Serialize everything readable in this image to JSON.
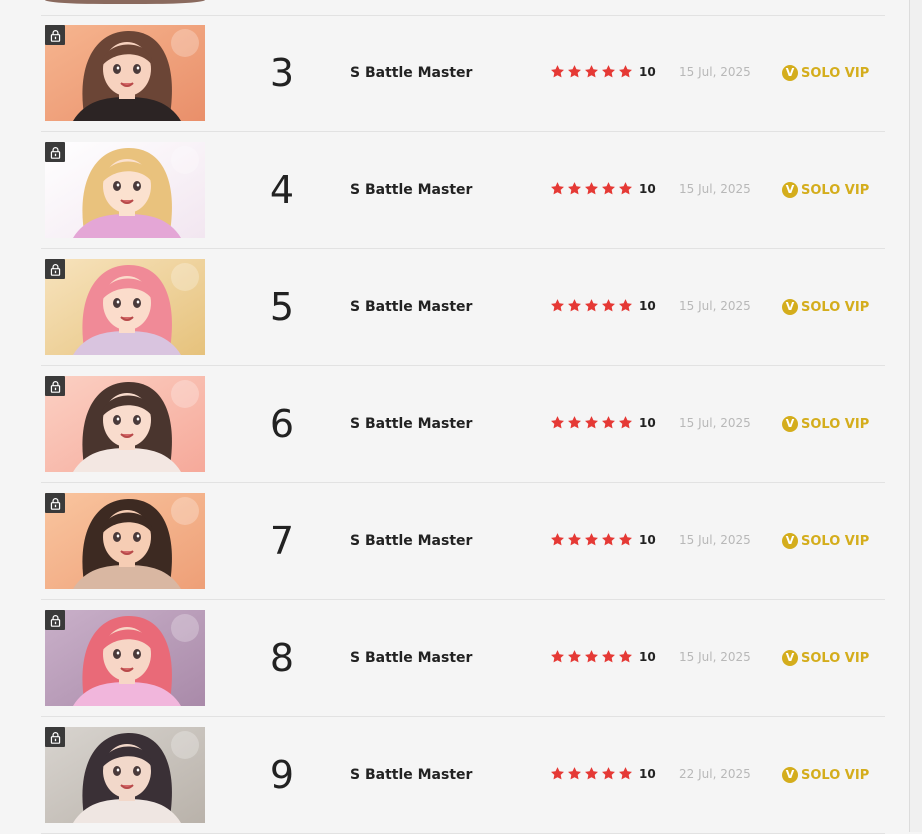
{
  "chapters": [
    {
      "number": "3",
      "title": "S Battle Master",
      "rating": "10",
      "date": "15 Jul, 2025",
      "vip_label": "SOLO VIP",
      "vip_icon": "V",
      "bg1": "#f6b58f",
      "bg2": "#e98f6a",
      "hair": "#6b4536",
      "skin": "#f7d2bf",
      "outfit": "#2c2424"
    },
    {
      "number": "4",
      "title": "S Battle Master",
      "rating": "10",
      "date": "15 Jul, 2025",
      "vip_label": "SOLO VIP",
      "vip_icon": "V",
      "bg1": "#ffffff",
      "bg2": "#f2e6f0",
      "hair": "#e9c27d",
      "skin": "#fbe1cf",
      "outfit": "#e4a6d6"
    },
    {
      "number": "5",
      "title": "S Battle Master",
      "rating": "10",
      "date": "15 Jul, 2025",
      "vip_label": "SOLO VIP",
      "vip_icon": "V",
      "bg1": "#f7e3bd",
      "bg2": "#e6c27c",
      "hair": "#f08a97",
      "skin": "#fbdccb",
      "outfit": "#d9c4df"
    },
    {
      "number": "6",
      "title": "S Battle Master",
      "rating": "10",
      "date": "15 Jul, 2025",
      "vip_label": "SOLO VIP",
      "vip_icon": "V",
      "bg1": "#fbd0c3",
      "bg2": "#f6a99a",
      "hair": "#4a352e",
      "skin": "#f9dccd",
      "outfit": "#f3e7e2"
    },
    {
      "number": "7",
      "title": "S Battle Master",
      "rating": "10",
      "date": "15 Jul, 2025",
      "vip_label": "SOLO VIP",
      "vip_icon": "V",
      "bg1": "#f9c59f",
      "bg2": "#ee9f77",
      "hair": "#3d2a22",
      "skin": "#f6cdb4",
      "outfit": "#d9b7a2"
    },
    {
      "number": "8",
      "title": "S Battle Master",
      "rating": "10",
      "date": "15 Jul, 2025",
      "vip_label": "SOLO VIP",
      "vip_icon": "V",
      "bg1": "#c9b0c9",
      "bg2": "#a98aa9",
      "hair": "#e96a78",
      "skin": "#f7d6c6",
      "outfit": "#f1b6dc"
    },
    {
      "number": "9",
      "title": "S Battle Master",
      "rating": "10",
      "date": "22 Jul, 2025",
      "vip_label": "SOLO VIP",
      "vip_icon": "V",
      "bg1": "#d8d4cf",
      "bg2": "#b9b2aa",
      "hair": "#3a3036",
      "skin": "#f2d8ca",
      "outfit": "#efe6e2"
    }
  ],
  "colors": {
    "star": "#e53935",
    "vip": "#d4ad1c",
    "date": "#b8b8b8",
    "text": "#222222",
    "divider": "#e2e2e2"
  },
  "icons": {
    "lock": "lock-icon",
    "star": "star-icon",
    "vip": "vip-coin-icon"
  }
}
